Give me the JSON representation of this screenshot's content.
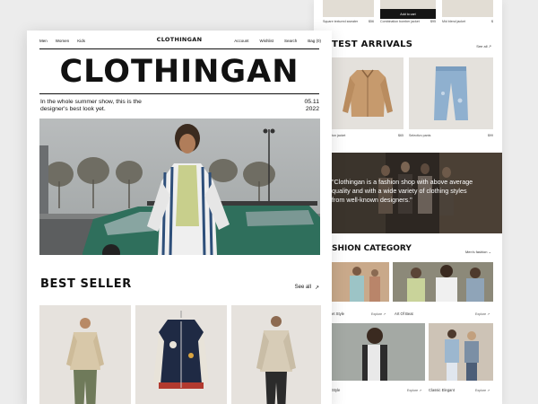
{
  "colors": {
    "card_bg": "#e6e2dd",
    "dark": "#111111",
    "accent_green": "#2f6f5c"
  },
  "back_page": {
    "top_strip": [
      {
        "name": "Square textured sweater",
        "price": "$56"
      },
      {
        "name": "Combination bomber jacket",
        "price": "$95",
        "button": "Add to cart"
      },
      {
        "name": "Mid blend jacket",
        "price": "$"
      }
    ],
    "latest_arrivals": {
      "title": "TEST ARRIVALS",
      "see_all": "See all",
      "items": [
        {
          "name": "ton jacket",
          "price": "$65"
        },
        {
          "name": "Selectivo pants",
          "price": "$99"
        }
      ]
    },
    "quote": "\"Clothingan is a fashion shop with above average quality and with a wide variety of clothing styles from well-known designers.\"",
    "category": {
      "title": "SHION CATEGORY",
      "select": "Men's fashion",
      "items": [
        {
          "label": "et Style",
          "explore": "Explore"
        },
        {
          "label": "Art Of Beat",
          "explore": "Explore"
        },
        {
          "label": "Style",
          "explore": "Explore"
        },
        {
          "label": "Classic Elegant",
          "explore": "Explore"
        }
      ]
    }
  },
  "front_page": {
    "nav": {
      "left": [
        "Men",
        "Women",
        "Kids"
      ],
      "logo": "CLOTHINGAN",
      "right": [
        "Account",
        "Wishlist",
        "Search",
        "Bag (0)"
      ]
    },
    "hero": {
      "title": "CLOTHINGAN",
      "subtitle": "In the whole summer show, this is the designer's best look yet.",
      "date_top": "05.11",
      "date_bottom": "2022"
    },
    "best_seller": {
      "title": "BEST SELLER",
      "see_all": "See all",
      "arrow": "↗"
    }
  }
}
